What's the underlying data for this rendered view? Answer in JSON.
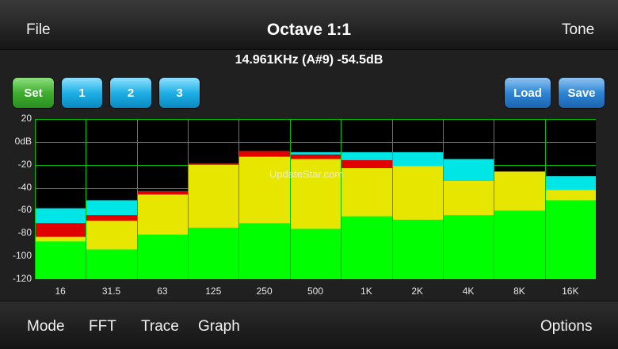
{
  "topbar": {
    "file": "File",
    "title": "Octave 1:1",
    "tone": "Tone"
  },
  "readout": "14.961KHz (A#9) -54.5dB",
  "buttons": {
    "set": "Set",
    "b1": "1",
    "b2": "2",
    "b3": "3",
    "load": "Load",
    "save": "Save"
  },
  "watermark": "UpdateStar.com",
  "bottombar": {
    "mode": "Mode",
    "fft": "FFT",
    "trace": "Trace",
    "graph": "Graph",
    "options": "Options"
  },
  "colors": {
    "green": "#00ff00",
    "yellow": "#e6e600",
    "red": "#e00000",
    "cyan": "#00e5e5",
    "grid": "#00c000"
  },
  "chart_data": {
    "type": "bar",
    "categories": [
      "16",
      "31.5",
      "63",
      "125",
      "250",
      "500",
      "1K",
      "2K",
      "4K",
      "8K",
      "16K"
    ],
    "y_tick_labels": [
      "20",
      "0dB",
      "-20",
      "-40",
      "-60",
      "-80",
      "-100",
      "-120"
    ],
    "ylim": [
      -120,
      20
    ],
    "y_ticks": [
      20,
      0,
      -20,
      -40,
      -60,
      -80,
      -100,
      -120
    ],
    "series": [
      {
        "values": [
          -87,
          -94,
          -81,
          -75,
          -71,
          -76,
          -65,
          -68,
          -64,
          -60,
          -51
        ]
      },
      {
        "values": [
          -83,
          -69,
          -46,
          -20,
          -13,
          -15,
          -23,
          -21,
          -34,
          -26,
          -42
        ]
      },
      {
        "values": [
          -71,
          -64,
          -43,
          -19,
          -8,
          -11,
          -16,
          -21,
          -34,
          -26,
          -42
        ]
      },
      {
        "values": [
          -58,
          -51,
          -43,
          -19,
          -8,
          -9,
          -9,
          -9,
          -15,
          -26,
          -30
        ]
      }
    ]
  }
}
